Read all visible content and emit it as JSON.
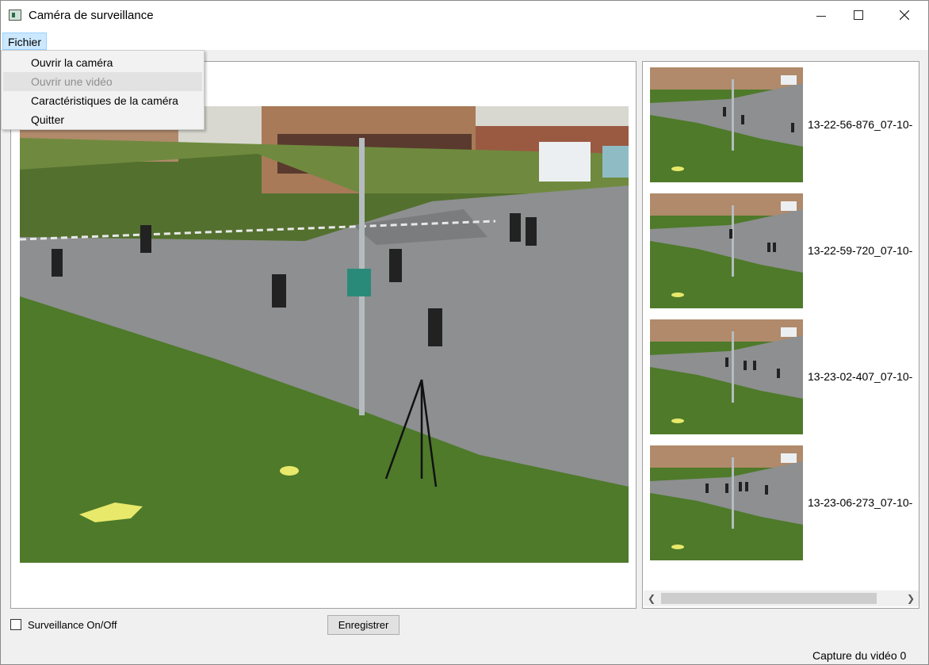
{
  "window": {
    "title": "Caméra de surveillance"
  },
  "menubar": {
    "fichier": "Fichier"
  },
  "menu": {
    "items": [
      {
        "label": "Ouvrir la caméra",
        "enabled": true
      },
      {
        "label": "Ouvrir une vidéo",
        "enabled": false
      },
      {
        "label": "Caractéristiques de la caméra",
        "enabled": true
      },
      {
        "label": "Quitter",
        "enabled": true
      }
    ]
  },
  "captures": [
    {
      "label": "13-22-56-876_07-10-"
    },
    {
      "label": "13-22-59-720_07-10-"
    },
    {
      "label": "13-23-02-407_07-10-"
    },
    {
      "label": "13-23-06-273_07-10-"
    }
  ],
  "controls": {
    "surveillance_label": "Surveillance On/Off",
    "surveillance_checked": false,
    "record_label": "Enregistrer"
  },
  "status": {
    "text": "Capture du vidéo 0"
  }
}
